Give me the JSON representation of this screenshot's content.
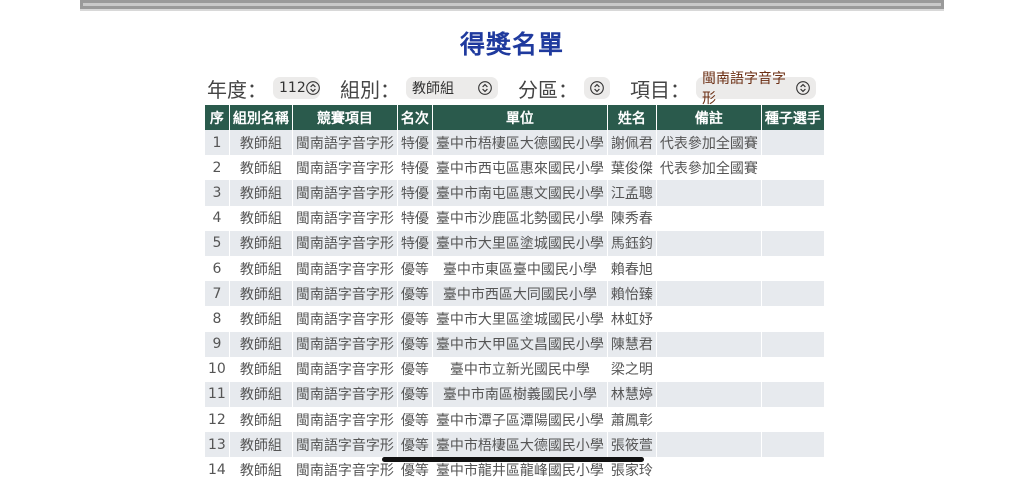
{
  "title": "得獎名單",
  "filters": {
    "year_label": "年度：",
    "year_value": "112",
    "group_label": "組別：",
    "group_value": "教師組",
    "area_label": "分區：",
    "area_value": "",
    "item_label": "項目：",
    "item_value": "閩南語字音字形"
  },
  "table": {
    "headers": [
      "序",
      "組別名稱",
      "競賽項目",
      "名次",
      "單位",
      "姓名",
      "備註",
      "種子選手"
    ],
    "rows": [
      [
        "1",
        "教師組",
        "閩南語字音字形",
        "特優",
        "臺中市梧棲區大德國民小學",
        "謝佩君",
        "代表參加全國賽",
        ""
      ],
      [
        "2",
        "教師組",
        "閩南語字音字形",
        "特優",
        "臺中市西屯區惠來國民小學",
        "葉俊傑",
        "代表參加全國賽",
        ""
      ],
      [
        "3",
        "教師組",
        "閩南語字音字形",
        "特優",
        "臺中市南屯區惠文國民小學",
        "江孟聰",
        "",
        ""
      ],
      [
        "4",
        "教師組",
        "閩南語字音字形",
        "特優",
        "臺中市沙鹿區北勢國民小學",
        "陳秀春",
        "",
        ""
      ],
      [
        "5",
        "教師組",
        "閩南語字音字形",
        "特優",
        "臺中市大里區塗城國民小學",
        "馬鈺鈞",
        "",
        ""
      ],
      [
        "6",
        "教師組",
        "閩南語字音字形",
        "優等",
        "臺中市東區臺中國民小學",
        "賴春旭",
        "",
        ""
      ],
      [
        "7",
        "教師組",
        "閩南語字音字形",
        "優等",
        "臺中市西區大同國民小學",
        "賴怡臻",
        "",
        ""
      ],
      [
        "8",
        "教師組",
        "閩南語字音字形",
        "優等",
        "臺中市大里區塗城國民小學",
        "林虹妤",
        "",
        ""
      ],
      [
        "9",
        "教師組",
        "閩南語字音字形",
        "優等",
        "臺中市大甲區文昌國民小學",
        "陳慧君",
        "",
        ""
      ],
      [
        "10",
        "教師組",
        "閩南語字音字形",
        "優等",
        "臺中市立新光國民中學",
        "梁之明",
        "",
        ""
      ],
      [
        "11",
        "教師組",
        "閩南語字音字形",
        "優等",
        "臺中市南區樹義國民小學",
        "林慧婷",
        "",
        ""
      ],
      [
        "12",
        "教師組",
        "閩南語字音字形",
        "優等",
        "臺中市潭子區潭陽國民小學",
        "蕭鳳彰",
        "",
        ""
      ],
      [
        "13",
        "教師組",
        "閩南語字音字形",
        "優等",
        "臺中市梧棲區大德國民小學",
        "張筱萱",
        "",
        ""
      ],
      [
        "14",
        "教師組",
        "閩南語字音字形",
        "優等",
        "臺中市龍井區龍峰國民小學",
        "張家玲",
        "",
        ""
      ]
    ]
  }
}
